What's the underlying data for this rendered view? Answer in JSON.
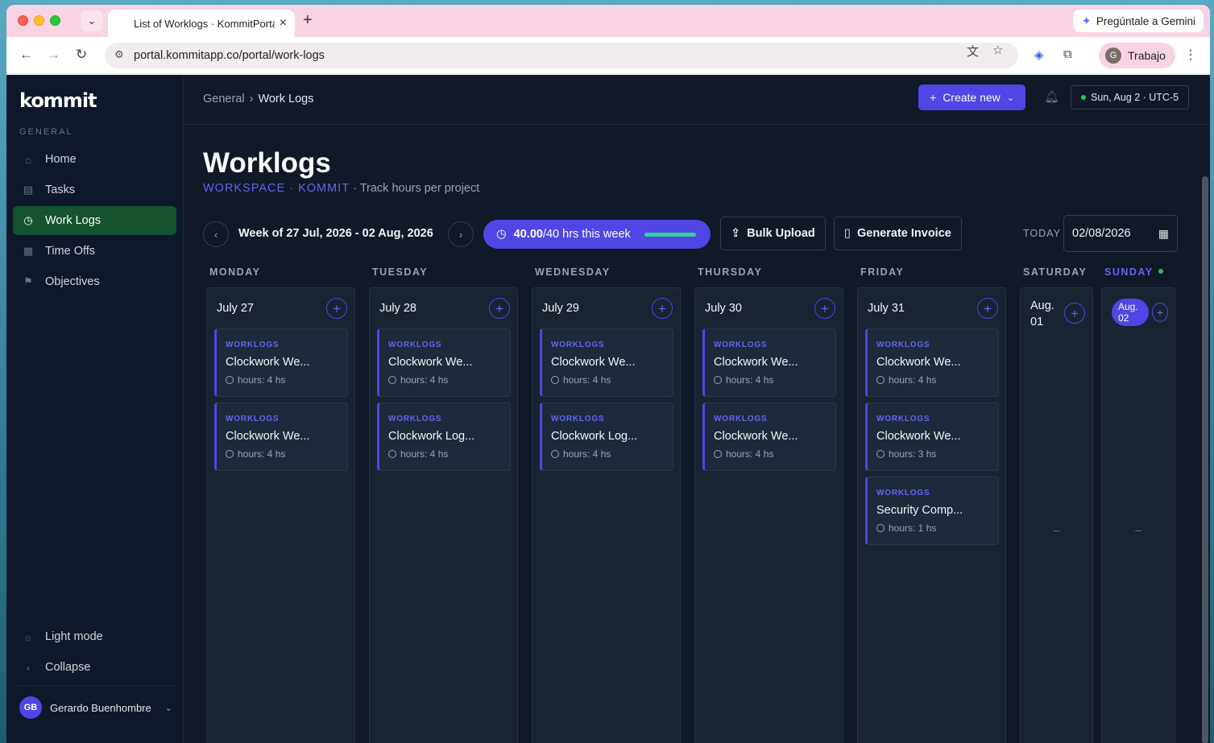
{
  "browser": {
    "tab_title": "List of Worklogs · KommitPortal",
    "url": "portal.kommitapp.co/portal/work-logs",
    "gemini_label": "Pregúntale a Gemini",
    "profile_initial": "G",
    "profile_label": "Trabajo"
  },
  "sidebar": {
    "logo": "kommit",
    "section": "GENERAL",
    "items": [
      {
        "label": "Home",
        "icon": "home-icon",
        "active": false
      },
      {
        "label": "Tasks",
        "icon": "clipboard-icon",
        "active": false
      },
      {
        "label": "Work Logs",
        "icon": "clock-icon",
        "active": true
      },
      {
        "label": "Time Offs",
        "icon": "calendar-icon",
        "active": false
      },
      {
        "label": "Objectives",
        "icon": "flag-icon",
        "active": false
      }
    ],
    "light_mode": "Light mode",
    "collapse": "Collapse",
    "user": {
      "initials": "GB",
      "name": "Gerardo Buenhombre"
    }
  },
  "header": {
    "breadcrumb": [
      "General",
      "Work Logs"
    ],
    "create_label": "Create new",
    "date_status": "Sun, Aug 2 · UTC-5"
  },
  "page": {
    "title": "Worklogs",
    "workspace": "WORKSPACE · KOMMIT",
    "subtitle": "· Track hours per project",
    "week_label": "Week of 27 Jul, 2026 - 02 Aug, 2026",
    "hours_logged": "40.00",
    "hours_suffix": "/40 hrs this week",
    "progress": 1.0,
    "bulk_upload": "Bulk Upload",
    "generate_invoice": "Generate Invoice",
    "today_label": "TODAY",
    "date_value": "02/08/2026"
  },
  "colors": {
    "accent": "#4f46e5",
    "active_nav": "#14532d",
    "progress": "#34d399"
  },
  "days": [
    {
      "name": "MONDAY",
      "date": "July 27",
      "entries": [
        {
          "tag": "WORKLOGS",
          "title": "Clockwork We...",
          "hours": "hours: 4 hs"
        },
        {
          "tag": "WORKLOGS",
          "title": "Clockwork We...",
          "hours": "hours: 4 hs"
        }
      ]
    },
    {
      "name": "TUESDAY",
      "date": "July 28",
      "entries": [
        {
          "tag": "WORKLOGS",
          "title": "Clockwork We...",
          "hours": "hours: 4 hs"
        },
        {
          "tag": "WORKLOGS",
          "title": "Clockwork Log...",
          "hours": "hours: 4 hs"
        }
      ]
    },
    {
      "name": "WEDNESDAY",
      "date": "July 29",
      "entries": [
        {
          "tag": "WORKLOGS",
          "title": "Clockwork We...",
          "hours": "hours: 4 hs"
        },
        {
          "tag": "WORKLOGS",
          "title": "Clockwork Log...",
          "hours": "hours: 4 hs"
        }
      ]
    },
    {
      "name": "THURSDAY",
      "date": "July 30",
      "entries": [
        {
          "tag": "WORKLOGS",
          "title": "Clockwork We...",
          "hours": "hours: 4 hs"
        },
        {
          "tag": "WORKLOGS",
          "title": "Clockwork We...",
          "hours": "hours: 4 hs"
        }
      ]
    },
    {
      "name": "FRIDAY",
      "date": "July 31",
      "entries": [
        {
          "tag": "WORKLOGS",
          "title": "Clockwork We...",
          "hours": "hours: 4 hs"
        },
        {
          "tag": "WORKLOGS",
          "title": "Clockwork We...",
          "hours": "hours: 3 hs"
        },
        {
          "tag": "WORKLOGS",
          "title": "Security Comp...",
          "hours": "hours: 1 hs"
        }
      ]
    },
    {
      "name": "SATURDAY",
      "date_line1": "Aug.",
      "date_line2": "01",
      "empty": "–"
    },
    {
      "name": "SUNDAY",
      "date_line1": "Aug.",
      "date_line2": "02",
      "empty": "–"
    }
  ]
}
